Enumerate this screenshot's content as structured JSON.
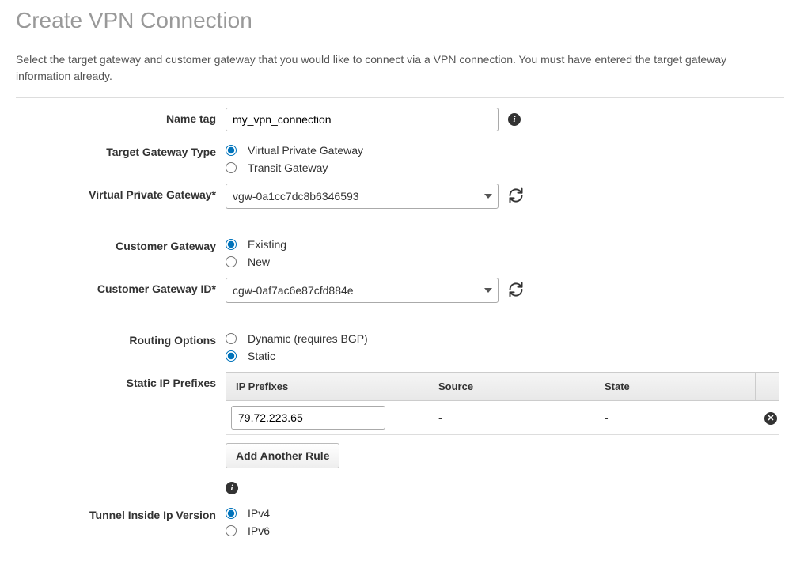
{
  "title": "Create VPN Connection",
  "description": "Select the target gateway and customer gateway that you would like to connect via a VPN connection. You must have entered the target gateway information already.",
  "fields": {
    "name_tag": {
      "label": "Name tag",
      "value": "my_vpn_connection"
    },
    "target_gateway_type": {
      "label": "Target Gateway Type",
      "options": {
        "vpg": "Virtual Private Gateway",
        "tgw": "Transit Gateway"
      },
      "selected": "vpg"
    },
    "virtual_private_gateway": {
      "label": "Virtual Private Gateway*",
      "value": "vgw-0a1cc7dc8b6346593"
    },
    "customer_gateway": {
      "label": "Customer Gateway",
      "options": {
        "existing": "Existing",
        "new": "New"
      },
      "selected": "existing"
    },
    "customer_gateway_id": {
      "label": "Customer Gateway ID*",
      "value": "cgw-0af7ac6e87cfd884e"
    },
    "routing_options": {
      "label": "Routing Options",
      "options": {
        "dynamic": "Dynamic (requires BGP)",
        "static": "Static"
      },
      "selected": "static"
    },
    "static_ip_prefixes": {
      "label": "Static IP Prefixes",
      "columns": {
        "prefixes": "IP Prefixes",
        "source": "Source",
        "state": "State"
      },
      "rows": [
        {
          "prefix": "79.72.223.65",
          "source": "-",
          "state": "-"
        }
      ],
      "add_button": "Add Another Rule"
    },
    "tunnel_ip_version": {
      "label": "Tunnel Inside Ip Version",
      "options": {
        "ipv4": "IPv4",
        "ipv6": "IPv6"
      },
      "selected": "ipv4"
    }
  },
  "icons": {
    "info": "i",
    "remove": "✕"
  }
}
